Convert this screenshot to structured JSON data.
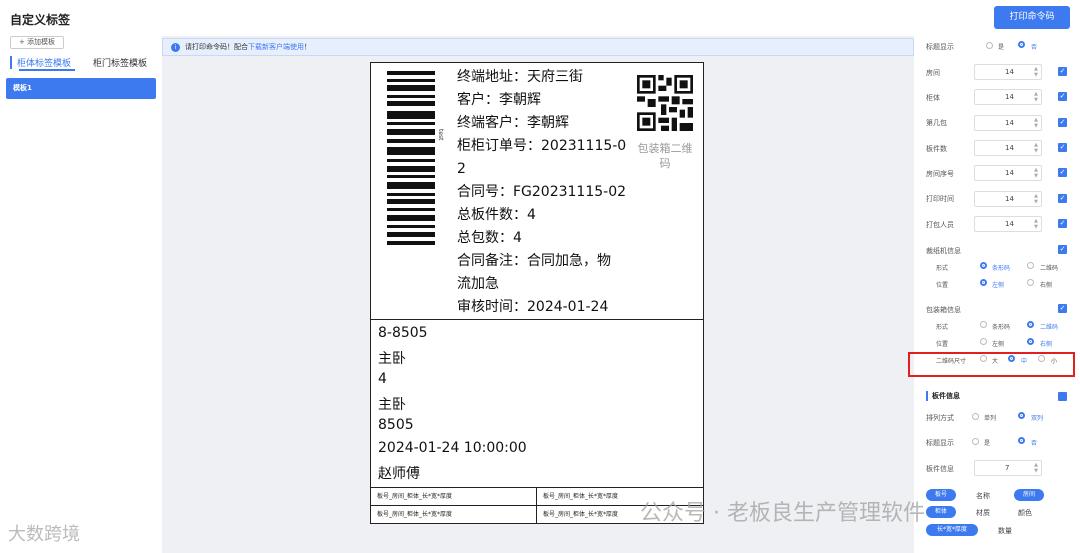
{
  "header": {
    "title": "自定义标签",
    "print_button": "打印命令码"
  },
  "sidebar": {
    "add_button": "添加模板",
    "tabs": [
      "柜体标签模板",
      "柜门标签模板"
    ],
    "templates": [
      "模板1"
    ]
  },
  "notice": {
    "text": "请打印命令码！配合",
    "link": "下载新客户端使用",
    "tail": "！"
  },
  "label": {
    "barcode_text": "test",
    "info_lines": [
      "终端地址：天府三街",
      "客户：李朝辉",
      "终端客户：李朝辉",
      "柜柜订单号：20231115-0",
      "2",
      "合同号：FG20231115-02",
      "总板件数：4",
      "总包数：4",
      "合同备注：合同加急，物",
      "流加急",
      "审核时间：2024-01-24"
    ],
    "qr_caption": "包装箱二维码",
    "mid_lines": [
      "8-8505",
      "主卧",
      "4",
      "主卧",
      "8505",
      "2024-01-24 10:00:00",
      "赵师傅"
    ],
    "table_cells": [
      "板号_房间_柜体_长*宽*厚度",
      "板号_房间_柜体_长*宽*厚度",
      "板号_房间_柜体_长*宽*厚度",
      "板号_房间_柜体_长*宽*厚度"
    ]
  },
  "settings": {
    "title_display": {
      "label": "标题显示",
      "yes": "是",
      "no": "否"
    },
    "fields": [
      {
        "label": "房间",
        "value": "14"
      },
      {
        "label": "柜体",
        "value": "14"
      },
      {
        "label": "第几包",
        "value": "14"
      },
      {
        "label": "板件数",
        "value": "14"
      },
      {
        "label": "房间序号",
        "value": "14"
      },
      {
        "label": "打印时间",
        "value": "14"
      },
      {
        "label": "打包人员",
        "value": "14"
      }
    ],
    "cutter": {
      "label": "裁纸机信息",
      "form": "形式",
      "form_a": "条形码",
      "form_b": "二维码",
      "pos": "位置",
      "pos_a": "左侧",
      "pos_b": "右侧"
    },
    "pack": {
      "label": "包装箱信息",
      "form": "形式",
      "form_a": "条形码",
      "form_b": "二维码",
      "pos": "位置",
      "pos_a": "左侧",
      "pos_b": "右侧",
      "size": "二维码尺寸",
      "size_l": "大",
      "size_m": "中",
      "size_s": "小"
    },
    "panel": {
      "section": "板件信息",
      "order": "排列方式",
      "order_a": "单列",
      "order_b": "双列",
      "title_display": "标题显示",
      "yes": "是",
      "no": "否",
      "info": "板件信息",
      "info_value": "7",
      "tags": [
        "板号",
        "名称",
        "房间",
        "柜体",
        "材质",
        "颜色",
        "长*宽*厚度",
        "数量"
      ]
    }
  },
  "watermark": {
    "left": "大数跨境",
    "right": "公众号 · 老板良生产管理软件"
  },
  "colors": {
    "accent": "#3d7af0",
    "highlight": "#e02020"
  }
}
